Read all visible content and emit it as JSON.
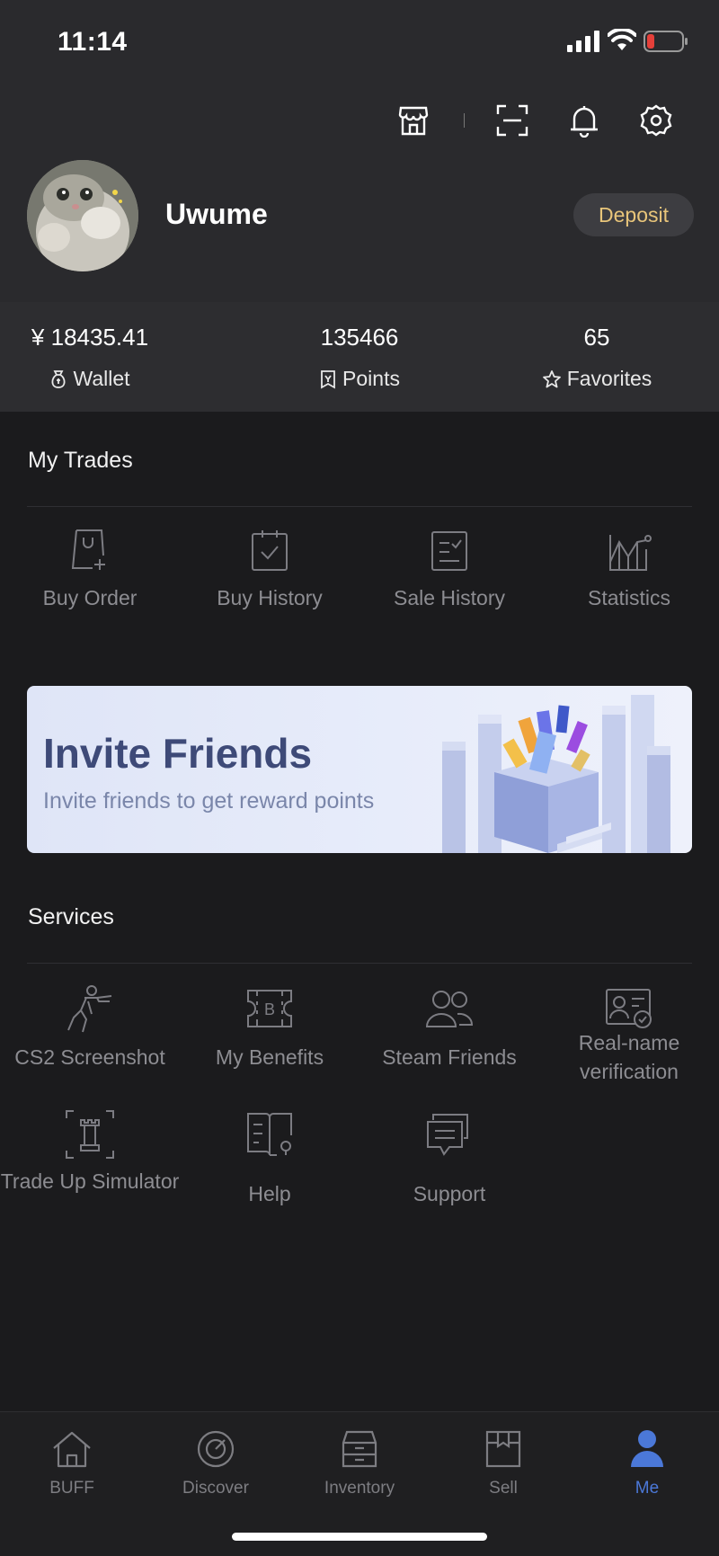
{
  "status_bar": {
    "time": "11:14"
  },
  "profile": {
    "username": "Uwume",
    "deposit_label": "Deposit"
  },
  "stats": [
    {
      "value": "¥ 18435.41",
      "label": "Wallet",
      "icon": "wallet-icon"
    },
    {
      "value": "135466",
      "label": "Points",
      "icon": "points-icon"
    },
    {
      "value": "65",
      "label": "Favorites",
      "icon": "star-icon"
    }
  ],
  "my_trades": {
    "title": "My Trades",
    "items": [
      {
        "label": "Buy Order",
        "icon": "buy-order-icon"
      },
      {
        "label": "Buy History",
        "icon": "buy-history-icon"
      },
      {
        "label": "Sale History",
        "icon": "sale-history-icon"
      },
      {
        "label": "Statistics",
        "icon": "statistics-icon"
      }
    ]
  },
  "banner": {
    "title": "Invite Friends",
    "subtitle": "Invite friends to get reward points"
  },
  "services": {
    "title": "Services",
    "items": [
      {
        "label": "CS2 Screenshot",
        "icon": "soldier-icon"
      },
      {
        "label": "My Benefits",
        "icon": "ticket-icon"
      },
      {
        "label": "Steam Friends",
        "icon": "friends-icon"
      },
      {
        "label": "Real-name verification",
        "icon": "id-card-icon"
      },
      {
        "label": "Trade Up Simulator",
        "icon": "chess-rook-icon"
      },
      {
        "label": "Help",
        "icon": "help-book-icon"
      },
      {
        "label": "Support",
        "icon": "chat-icon"
      }
    ]
  },
  "tabbar": [
    {
      "label": "BUFF",
      "icon": "home-icon"
    },
    {
      "label": "Discover",
      "icon": "compass-icon"
    },
    {
      "label": "Inventory",
      "icon": "inventory-icon"
    },
    {
      "label": "Sell",
      "icon": "sell-box-icon"
    },
    {
      "label": "Me",
      "icon": "user-icon",
      "active": true
    }
  ],
  "colors": {
    "accent": "#4b78d8",
    "deposit_text": "#e8c57a",
    "background": "#1b1b1d"
  }
}
